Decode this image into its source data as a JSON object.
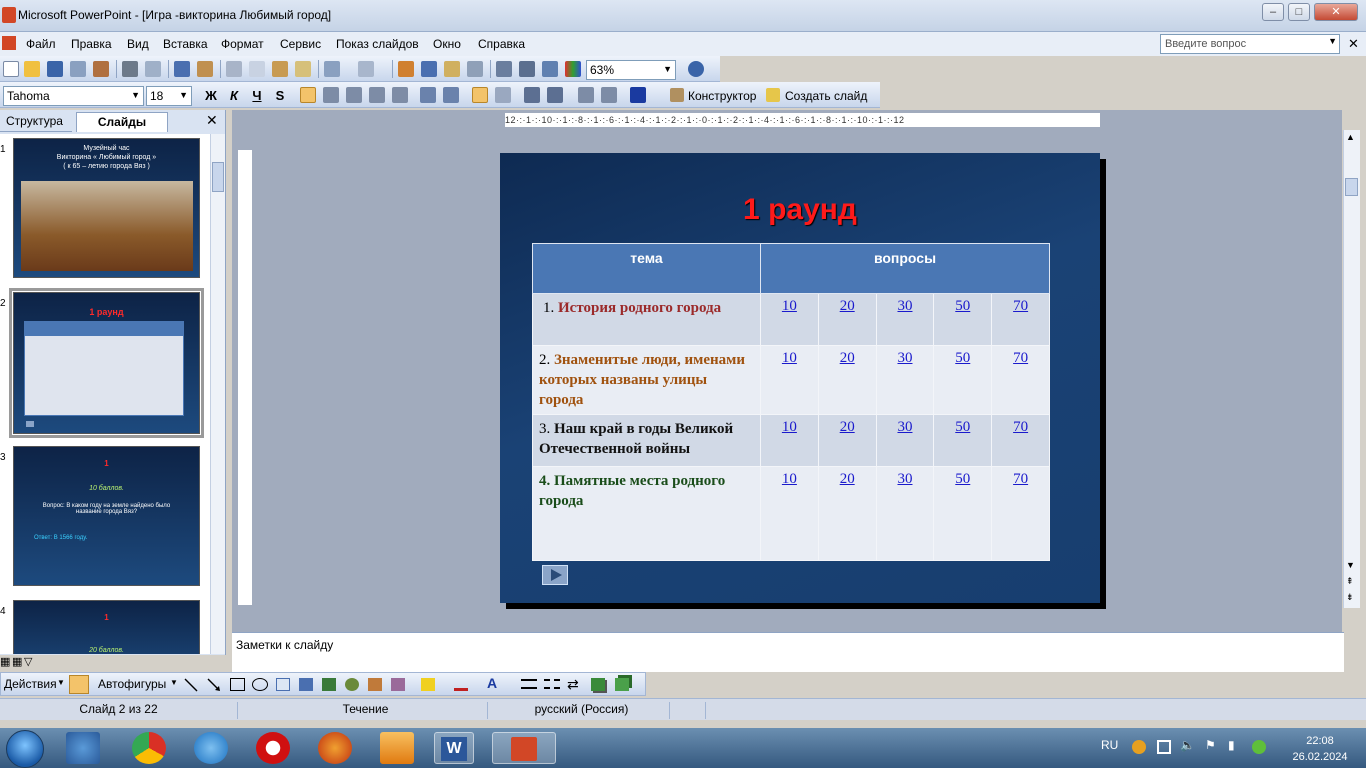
{
  "window": {
    "title": "Microsoft PowerPoint - [Игра -викторина Любимый город]",
    "min_label": "–",
    "max_label": "□",
    "close_label": "✕"
  },
  "menu": {
    "items": [
      "Файл",
      "Правка",
      "Вид",
      "Вставка",
      "Формат",
      "Сервис",
      "Показ слайдов",
      "Окно",
      "Справка"
    ],
    "help_placeholder": "Введите вопрос"
  },
  "standard_toolbar": {
    "zoom": "63%",
    "icons": [
      "new-icon",
      "open-icon",
      "save-icon",
      "permission-icon",
      "email-icon",
      "print-icon",
      "print-preview-icon",
      "spelling-icon",
      "research-icon",
      "cut-icon",
      "copy-icon",
      "paste-icon",
      "format-painter-icon",
      "undo-icon",
      "redo-icon",
      "insert-chart-icon",
      "insert-table-icon",
      "tables-borders-icon",
      "insert-hyperlink-icon",
      "expand-icon",
      "show-formatting-icon",
      "grid-icon",
      "color-grayscale-icon",
      "help-icon"
    ]
  },
  "format_toolbar": {
    "font": "Tahoma",
    "size": "18",
    "bold": "Ж",
    "italic": "К",
    "underline": "Ч",
    "shadow": "S",
    "designer": "Конструктор",
    "new_slide": "Создать слайд"
  },
  "panel": {
    "tab_outline": "Структура",
    "tab_slides": "Слайды",
    "close": "✕",
    "thumbs": [
      {
        "num": "1",
        "lines": [
          "Музейный час",
          "Викторина « Любимый город »",
          "( к 65 – летию города Вяз )"
        ]
      },
      {
        "num": "2",
        "title": "1 раунд"
      },
      {
        "num": "3",
        "title": "1",
        "lines": [
          "10 баллов.",
          "Вопрос: В каком году на земле найдено было название города Вяз?",
          "Ответ: В 1566 году."
        ]
      },
      {
        "num": "4",
        "title": "1",
        "lines": [
          "20 баллов."
        ]
      }
    ]
  },
  "ruler": {
    "horizontal": "12·:·1·:·10·:·1·:·8·:·1·:·6·:·1·:·4·:·1·:·2·:·1·:·0·:·1·:·2·:·1·:·4·:·1·:·6·:·1·:·8·:·1·:·10·:·1·:·12"
  },
  "slide": {
    "title": "1 раунд",
    "headers": [
      "тема",
      "вопросы"
    ],
    "rows": [
      {
        "num": "1.",
        "topic": "История родного города",
        "color": "#9b2a2a",
        "points": [
          "10",
          "20",
          "30",
          "50",
          "70"
        ]
      },
      {
        "num": "2.",
        "topic": "Знаменитые люди, именами которых названы улицы города",
        "color": "#a0520f",
        "points": [
          "10",
          "20",
          "30",
          "50",
          "70"
        ]
      },
      {
        "num": "3.",
        "topic": "Наш край в годы Великой Отечественной войны",
        "color": "#111111",
        "points": [
          "10",
          "20",
          "30",
          "50",
          "70"
        ]
      },
      {
        "num": "4.",
        "topic": "Памятные места родного города",
        "color": "#1a4d1a",
        "points": [
          "10",
          "20",
          "30",
          "50",
          "70"
        ]
      }
    ]
  },
  "notes": {
    "placeholder": "Заметки к слайду"
  },
  "drawing_toolbar": {
    "actions": "Действия",
    "autoshapes": "Автофигуры"
  },
  "status": {
    "slide": "Слайд 2 из 22",
    "design": "Течение",
    "language": "русский (Россия)"
  },
  "taskbar": {
    "lang": "RU",
    "time": "22:08",
    "date": "26.02.2024",
    "apps": [
      "windows-explorer-icon",
      "chrome-icon",
      "internet-explorer-icon",
      "opera-icon",
      "firefox-icon",
      "media-player-icon",
      "word-icon",
      "powerpoint-icon"
    ]
  },
  "colors": {
    "accent": "#4a77b4",
    "title_red": "#ff1a1a"
  }
}
